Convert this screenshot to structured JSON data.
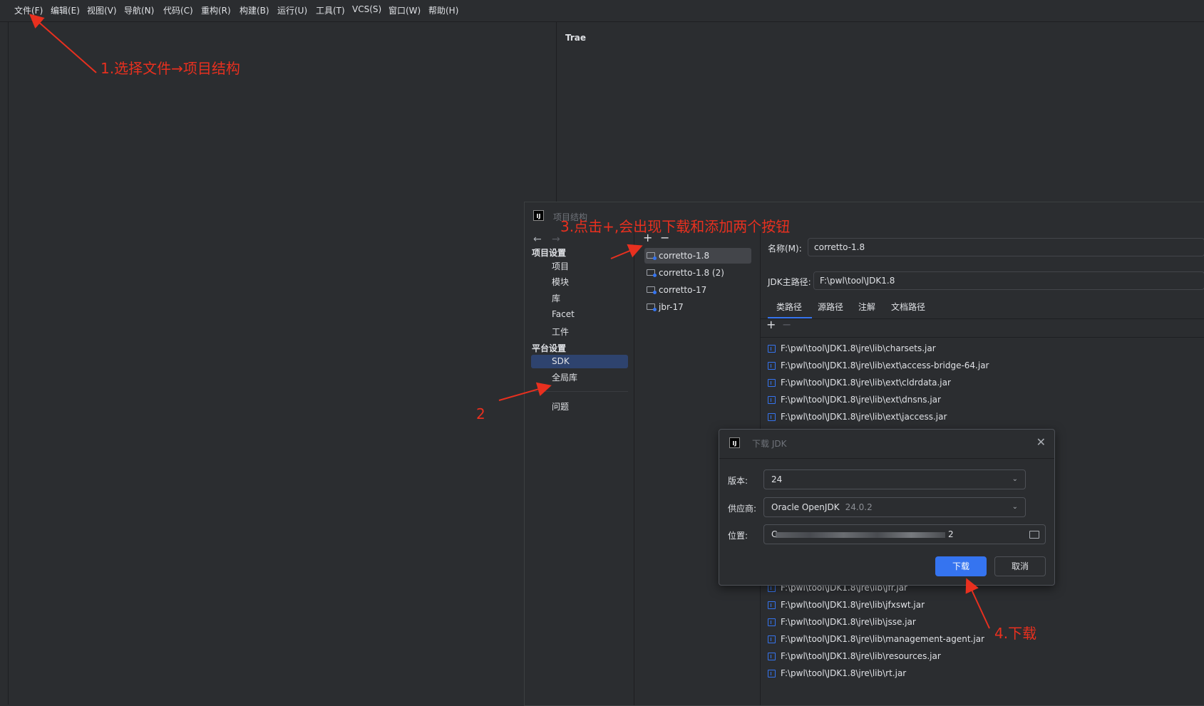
{
  "menu": [
    "文件(F)",
    "编辑(E)",
    "视图(V)",
    "导航(N)",
    "代码(C)",
    "重构(R)",
    "构建(B)",
    "运行(U)",
    "工具(T)",
    "VCS(S)",
    "窗口(W)",
    "帮助(H)"
  ],
  "right_panel": {
    "title": "Trae"
  },
  "annotations": {
    "step1": "1.选择文件→项目结构",
    "step2": "2",
    "step3": "3.点击+,会出现下载和添加两个按钮",
    "step4": "4.下载",
    "color": "#e8301f"
  },
  "project_structure": {
    "logo": "IJ",
    "title": "项目结构",
    "nav": {
      "back": "←",
      "forward": "→",
      "project_settings": "项目设置",
      "items_project": [
        "项目",
        "模块",
        "库",
        "Facet",
        "工件"
      ],
      "platform_settings": "平台设置",
      "items_platform": [
        "SDK",
        "全局库"
      ],
      "problems": "问题"
    },
    "toolbar": {
      "add": "+",
      "remove": "−"
    },
    "sdks": [
      "corretto-1.8",
      "corretto-1.8 (2)",
      "corretto-17",
      "jbr-17"
    ],
    "detail": {
      "name_label": "名称(M):",
      "name_value": "corretto-1.8",
      "home_label": "JDK主路径:",
      "home_value": "F:\\pwl\\tool\\JDK1.8",
      "tabs": [
        "类路径",
        "源路径",
        "注解",
        "文档路径"
      ],
      "toolbar_add": "+",
      "toolbar_remove": "−",
      "jars_top": [
        "F:\\pwl\\tool\\JDK1.8\\jre\\lib\\charsets.jar",
        "F:\\pwl\\tool\\JDK1.8\\jre\\lib\\ext\\access-bridge-64.jar",
        "F:\\pwl\\tool\\JDK1.8\\jre\\lib\\ext\\cldrdata.jar",
        "F:\\pwl\\tool\\JDK1.8\\jre\\lib\\ext\\dnsns.jar",
        "F:\\pwl\\tool\\JDK1.8\\jre\\lib\\ext\\jaccess.jar"
      ],
      "jars_bottom": [
        "F:\\pwl\\tool\\JDK1.8\\jre\\lib\\jfr.jar",
        "F:\\pwl\\tool\\JDK1.8\\jre\\lib\\jfxswt.jar",
        "F:\\pwl\\tool\\JDK1.8\\jre\\lib\\jsse.jar",
        "F:\\pwl\\tool\\JDK1.8\\jre\\lib\\management-agent.jar",
        "F:\\pwl\\tool\\JDK1.8\\jre\\lib\\resources.jar",
        "F:\\pwl\\tool\\JDK1.8\\jre\\lib\\rt.jar"
      ]
    }
  },
  "download_dialog": {
    "logo": "IJ",
    "title": "下载 JDK",
    "close": "✕",
    "version_label": "版本:",
    "version_value": "24",
    "vendor_label": "供应商:",
    "vendor_value": "Oracle OpenJDK",
    "vendor_version": "24.0.2",
    "location_label": "位置:",
    "location_start": "C",
    "location_end": "2",
    "download_button": "下载",
    "cancel_button": "取消",
    "chevron": "⌄"
  }
}
